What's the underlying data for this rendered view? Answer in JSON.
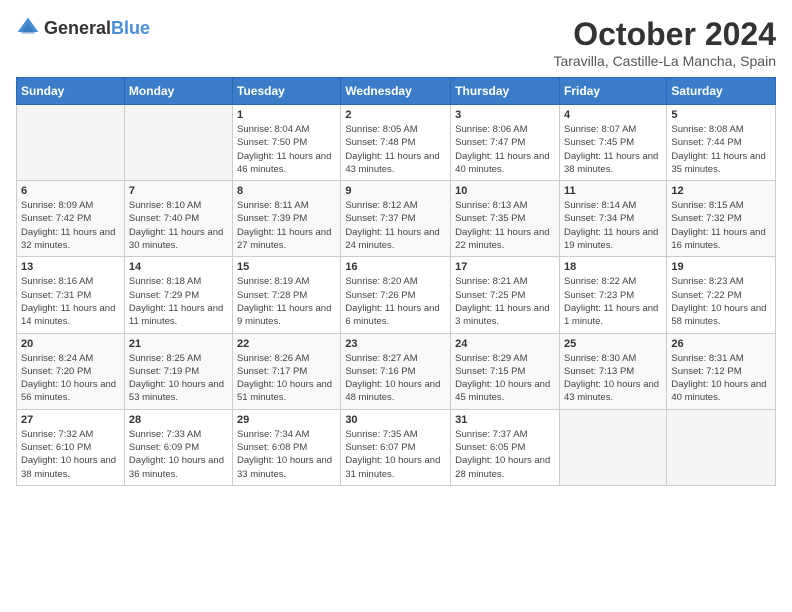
{
  "logo": {
    "general": "General",
    "blue": "Blue"
  },
  "title": "October 2024",
  "location": "Taravilla, Castille-La Mancha, Spain",
  "days_of_week": [
    "Sunday",
    "Monday",
    "Tuesday",
    "Wednesday",
    "Thursday",
    "Friday",
    "Saturday"
  ],
  "weeks": [
    [
      {
        "day": "",
        "info": ""
      },
      {
        "day": "",
        "info": ""
      },
      {
        "day": "1",
        "info": "Sunrise: 8:04 AM\nSunset: 7:50 PM\nDaylight: 11 hours and 46 minutes."
      },
      {
        "day": "2",
        "info": "Sunrise: 8:05 AM\nSunset: 7:48 PM\nDaylight: 11 hours and 43 minutes."
      },
      {
        "day": "3",
        "info": "Sunrise: 8:06 AM\nSunset: 7:47 PM\nDaylight: 11 hours and 40 minutes."
      },
      {
        "day": "4",
        "info": "Sunrise: 8:07 AM\nSunset: 7:45 PM\nDaylight: 11 hours and 38 minutes."
      },
      {
        "day": "5",
        "info": "Sunrise: 8:08 AM\nSunset: 7:44 PM\nDaylight: 11 hours and 35 minutes."
      }
    ],
    [
      {
        "day": "6",
        "info": "Sunrise: 8:09 AM\nSunset: 7:42 PM\nDaylight: 11 hours and 32 minutes."
      },
      {
        "day": "7",
        "info": "Sunrise: 8:10 AM\nSunset: 7:40 PM\nDaylight: 11 hours and 30 minutes."
      },
      {
        "day": "8",
        "info": "Sunrise: 8:11 AM\nSunset: 7:39 PM\nDaylight: 11 hours and 27 minutes."
      },
      {
        "day": "9",
        "info": "Sunrise: 8:12 AM\nSunset: 7:37 PM\nDaylight: 11 hours and 24 minutes."
      },
      {
        "day": "10",
        "info": "Sunrise: 8:13 AM\nSunset: 7:35 PM\nDaylight: 11 hours and 22 minutes."
      },
      {
        "day": "11",
        "info": "Sunrise: 8:14 AM\nSunset: 7:34 PM\nDaylight: 11 hours and 19 minutes."
      },
      {
        "day": "12",
        "info": "Sunrise: 8:15 AM\nSunset: 7:32 PM\nDaylight: 11 hours and 16 minutes."
      }
    ],
    [
      {
        "day": "13",
        "info": "Sunrise: 8:16 AM\nSunset: 7:31 PM\nDaylight: 11 hours and 14 minutes."
      },
      {
        "day": "14",
        "info": "Sunrise: 8:18 AM\nSunset: 7:29 PM\nDaylight: 11 hours and 11 minutes."
      },
      {
        "day": "15",
        "info": "Sunrise: 8:19 AM\nSunset: 7:28 PM\nDaylight: 11 hours and 9 minutes."
      },
      {
        "day": "16",
        "info": "Sunrise: 8:20 AM\nSunset: 7:26 PM\nDaylight: 11 hours and 6 minutes."
      },
      {
        "day": "17",
        "info": "Sunrise: 8:21 AM\nSunset: 7:25 PM\nDaylight: 11 hours and 3 minutes."
      },
      {
        "day": "18",
        "info": "Sunrise: 8:22 AM\nSunset: 7:23 PM\nDaylight: 11 hours and 1 minute."
      },
      {
        "day": "19",
        "info": "Sunrise: 8:23 AM\nSunset: 7:22 PM\nDaylight: 10 hours and 58 minutes."
      }
    ],
    [
      {
        "day": "20",
        "info": "Sunrise: 8:24 AM\nSunset: 7:20 PM\nDaylight: 10 hours and 56 minutes."
      },
      {
        "day": "21",
        "info": "Sunrise: 8:25 AM\nSunset: 7:19 PM\nDaylight: 10 hours and 53 minutes."
      },
      {
        "day": "22",
        "info": "Sunrise: 8:26 AM\nSunset: 7:17 PM\nDaylight: 10 hours and 51 minutes."
      },
      {
        "day": "23",
        "info": "Sunrise: 8:27 AM\nSunset: 7:16 PM\nDaylight: 10 hours and 48 minutes."
      },
      {
        "day": "24",
        "info": "Sunrise: 8:29 AM\nSunset: 7:15 PM\nDaylight: 10 hours and 45 minutes."
      },
      {
        "day": "25",
        "info": "Sunrise: 8:30 AM\nSunset: 7:13 PM\nDaylight: 10 hours and 43 minutes."
      },
      {
        "day": "26",
        "info": "Sunrise: 8:31 AM\nSunset: 7:12 PM\nDaylight: 10 hours and 40 minutes."
      }
    ],
    [
      {
        "day": "27",
        "info": "Sunrise: 7:32 AM\nSunset: 6:10 PM\nDaylight: 10 hours and 38 minutes."
      },
      {
        "day": "28",
        "info": "Sunrise: 7:33 AM\nSunset: 6:09 PM\nDaylight: 10 hours and 36 minutes."
      },
      {
        "day": "29",
        "info": "Sunrise: 7:34 AM\nSunset: 6:08 PM\nDaylight: 10 hours and 33 minutes."
      },
      {
        "day": "30",
        "info": "Sunrise: 7:35 AM\nSunset: 6:07 PM\nDaylight: 10 hours and 31 minutes."
      },
      {
        "day": "31",
        "info": "Sunrise: 7:37 AM\nSunset: 6:05 PM\nDaylight: 10 hours and 28 minutes."
      },
      {
        "day": "",
        "info": ""
      },
      {
        "day": "",
        "info": ""
      }
    ]
  ]
}
